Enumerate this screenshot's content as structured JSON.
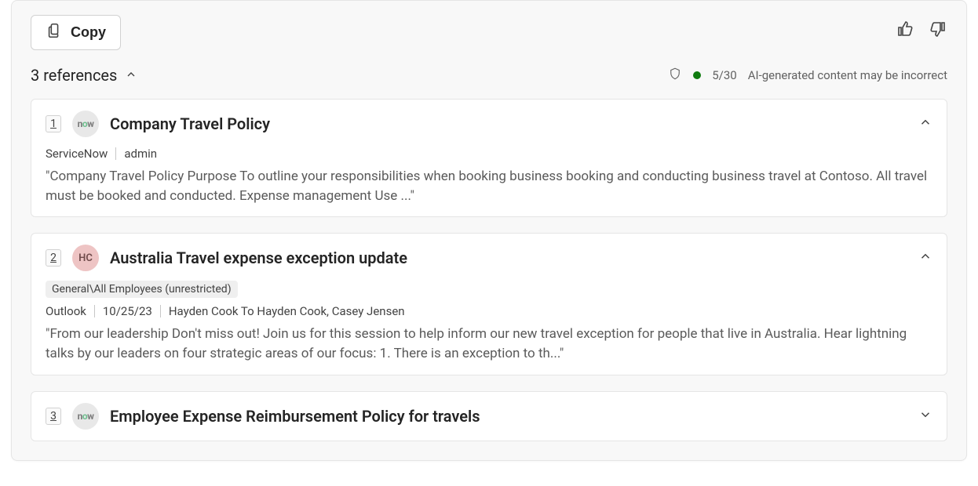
{
  "toolbar": {
    "copy_label": "Copy"
  },
  "references": {
    "toggle_label": "3 references",
    "expanded": true
  },
  "status": {
    "count": "5/30",
    "disclaimer": "AI-generated content may be incorrect"
  },
  "items": [
    {
      "num": "1",
      "avatar_kind": "now",
      "title": "Company Travel Policy",
      "expanded": true,
      "meta_source": "ServiceNow",
      "meta_author": "admin",
      "excerpt": "\"Company Travel Policy Purpose To outline your responsibilities when booking business booking and conducting business travel at Contoso. All travel must be booked and conducted. Expense management Use ...\""
    },
    {
      "num": "2",
      "avatar_kind": "hc",
      "avatar_text": "HC",
      "title": "Australia Travel expense exception update",
      "expanded": true,
      "tag": "General\\All Employees (unrestricted)",
      "meta_source": "Outlook",
      "meta_date": "10/25/23",
      "meta_from_to": "Hayden Cook To Hayden Cook, Casey Jensen",
      "excerpt": "\"From our leadership Don't miss out! Join us for this session to help inform our new travel exception for people that live in Australia. Hear lightning talks by our leaders on four strategic areas of our focus: 1. There is an exception to th...\""
    },
    {
      "num": "3",
      "avatar_kind": "now",
      "title": "Employee Expense Reimbursement Policy for travels",
      "expanded": false
    }
  ]
}
